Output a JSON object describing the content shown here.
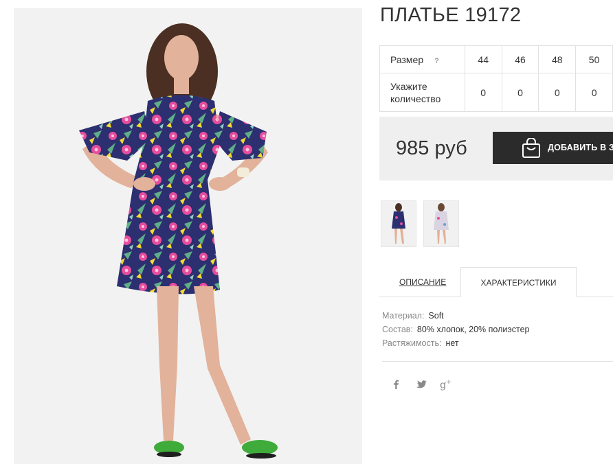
{
  "product": {
    "title": "ПЛАТЬЕ 19172"
  },
  "size_table": {
    "size_label": "Размер",
    "help_mark": "?",
    "sizes": [
      "44",
      "46",
      "48",
      "50"
    ],
    "quantity_label_1": "Укажите",
    "quantity_label_2": "количество",
    "quantities": [
      "0",
      "0",
      "0",
      "0"
    ]
  },
  "purchase": {
    "price": "985 руб",
    "cart_button_label": "ДОБАВИТЬ В ЗАКАЗ"
  },
  "tabs": {
    "description": "ОПИСАНИЕ",
    "characteristics": "ХАРАКТЕРИСТИКИ",
    "active": "characteristics"
  },
  "characteristics": [
    {
      "key": "Материал:",
      "value": "Soft"
    },
    {
      "key": "Состав:",
      "value": "80% хлопок, 20% полиэстер"
    },
    {
      "key": "Растяжимость:",
      "value": "нет"
    }
  ],
  "social_icons": [
    "facebook-icon",
    "twitter-icon",
    "google-plus-icon"
  ],
  "colors": {
    "button_bg": "#2b2b2b",
    "price_box_bg": "#efefef",
    "dress_navy": "#2c2f70",
    "flower_pink": "#e64d9d",
    "flower_yellow": "#f2dc32",
    "leaf_green": "#5fae88",
    "sandal_green": "#3eab3a"
  }
}
